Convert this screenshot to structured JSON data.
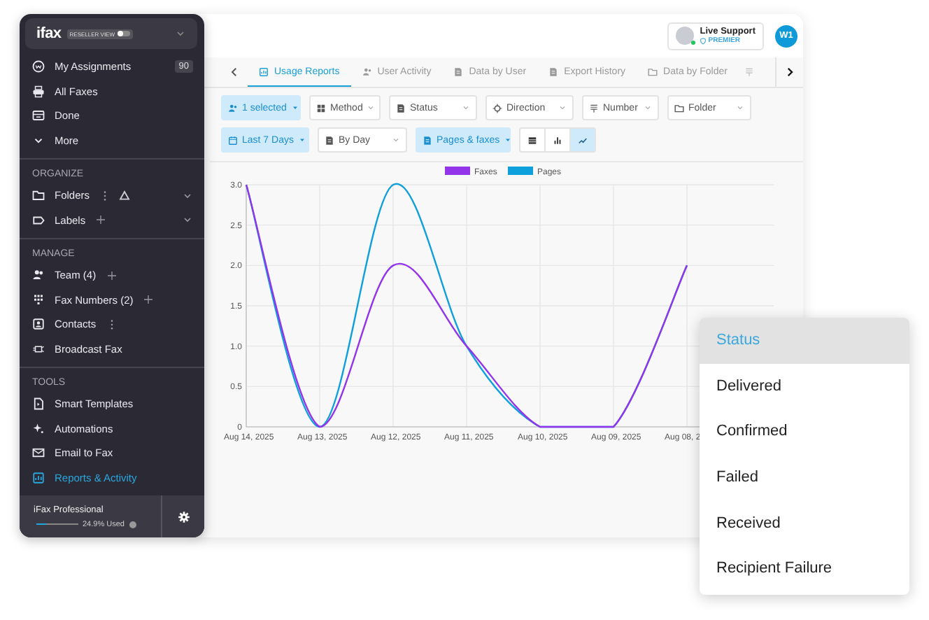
{
  "sidebar": {
    "brand": "ifax",
    "badge": "RESELLER VIEW",
    "toggle": {
      "on": false
    },
    "sections": [
      {
        "items": [
          {
            "label": "My Assignments",
            "count": "90",
            "selected": false
          },
          {
            "label": "All Faxes",
            "selected": false
          },
          {
            "label": "Done",
            "selected": false
          },
          {
            "label": "More",
            "selected": false
          }
        ]
      },
      {
        "title": "ORGANIZE",
        "items": [
          {
            "label": "Folders",
            "selected": false
          },
          {
            "label": "Labels",
            "selected": false
          }
        ]
      },
      {
        "title": "MANAGE",
        "items": [
          {
            "label": "Team (4)",
            "selected": false
          },
          {
            "label": "Fax Numbers (2)",
            "selected": false
          },
          {
            "label": "Contacts",
            "selected": false
          },
          {
            "label": "Broadcast Fax",
            "selected": false
          }
        ]
      },
      {
        "title": "TOOLS",
        "items": [
          {
            "label": "Smart Templates",
            "selected": false
          },
          {
            "label": "Automations",
            "selected": false
          },
          {
            "label": "Email to Fax",
            "selected": false
          },
          {
            "label": "Reports & Activity",
            "selected": true
          }
        ]
      }
    ],
    "plan": {
      "name": "iFax Professional",
      "level": 0.249,
      "usage": "24.9% Used"
    }
  },
  "header": {
    "support": {
      "label": "Live Support",
      "tier": "PREMIER"
    },
    "avatar": "W1"
  },
  "tabs": [
    {
      "label": "Usage Reports",
      "selected": true
    },
    {
      "label": "User Activity",
      "selected": false
    },
    {
      "label": "Data by User",
      "selected": false
    },
    {
      "label": "Export History",
      "selected": false
    },
    {
      "label": "Data by Folder",
      "selected": false
    }
  ],
  "filters": [
    {
      "label": "1 selected",
      "selected": true
    },
    {
      "label": "Method",
      "selected": false
    },
    {
      "label": "Status",
      "selected": false
    },
    {
      "label": "Direction",
      "selected": false
    },
    {
      "label": "Number",
      "selected": false
    },
    {
      "label": "Folder",
      "selected": false
    }
  ],
  "filters_2": [
    {
      "label": "Last 7 Days",
      "selected": true
    },
    {
      "label": "By Day",
      "selected": false
    },
    {
      "label": "Pages & faxes",
      "selected": true
    }
  ],
  "views": [
    {
      "kind": "table",
      "selected": false
    },
    {
      "kind": "bar",
      "selected": false
    },
    {
      "kind": "line",
      "selected": true
    }
  ],
  "chart_data": {
    "type": "line",
    "categories": [
      "Aug 14, 2025",
      "Aug 13, 2025",
      "Aug 12, 2025",
      "Aug 11, 2025",
      "Aug 10, 2025",
      "Aug 09, 2025",
      "Aug 08, 2"
    ],
    "series": [
      {
        "name": "Faxes",
        "color": "#9333ea",
        "values": [
          3,
          0,
          2,
          1,
          0,
          0,
          2
        ]
      },
      {
        "name": "Pages",
        "color": "#0ea0dc",
        "values": [
          3,
          0,
          3,
          1,
          0,
          0,
          2
        ]
      }
    ],
    "ylim": [
      0,
      3
    ],
    "yticks": [
      {
        "value": 0,
        "label": "0"
      },
      {
        "value": 0.5,
        "label": "0.5"
      },
      {
        "value": 1,
        "label": "1.0"
      },
      {
        "value": 1.5,
        "label": "1.5"
      },
      {
        "value": 2,
        "label": "2.0"
      },
      {
        "value": 2.5,
        "label": "2.5"
      },
      {
        "value": 3,
        "label": "3.0"
      }
    ],
    "grid": true,
    "legend": true
  },
  "dropdown": {
    "options": [
      {
        "label": "Status",
        "selected": true
      },
      {
        "label": "Delivered",
        "selected": false
      },
      {
        "label": "Confirmed",
        "selected": false
      },
      {
        "label": "Failed",
        "selected": false
      },
      {
        "label": "Received",
        "selected": false
      },
      {
        "label": "Recipient Failure",
        "selected": false
      }
    ]
  }
}
